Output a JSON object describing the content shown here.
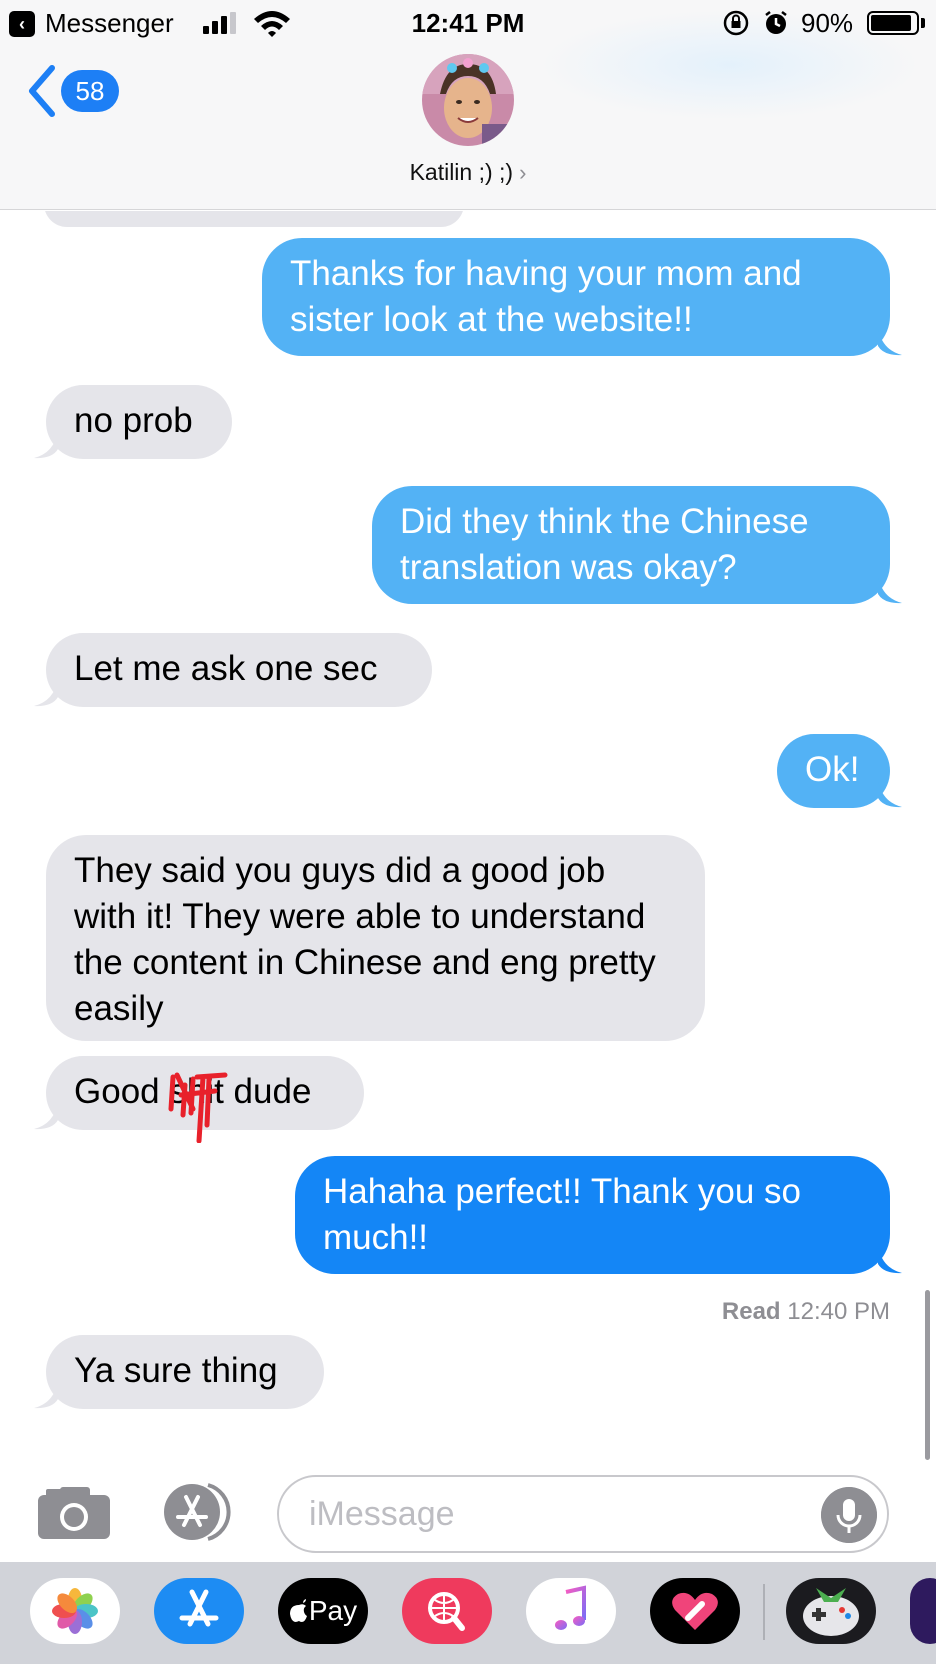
{
  "status_bar": {
    "back_app": "Messenger",
    "time": "12:41 PM",
    "battery": "90%",
    "battery_level": 0.9
  },
  "nav": {
    "unread_count": "58",
    "contact_name": "Katilin ;) ;)",
    "chevron": "›"
  },
  "messages": [
    {
      "from": "me",
      "text": "Thanks for having your mom and sister look at the website!!"
    },
    {
      "from": "them",
      "text": "no prob"
    },
    {
      "from": "me",
      "text": "Did they think the Chinese translation was okay?"
    },
    {
      "from": "them",
      "text": "Let me ask one sec"
    },
    {
      "from": "me",
      "text": "Ok!"
    },
    {
      "from": "them",
      "text": "They said you guys did a good job with it! They were able to understand the content in Chinese and eng pretty easily"
    },
    {
      "from": "them",
      "text_parts": [
        "Good ",
        "shit",
        " dude"
      ],
      "censored_word": "shit"
    },
    {
      "from": "me",
      "text": "Hahaha perfect!! Thank you so much!!"
    },
    {
      "from": "them",
      "text": "Ya sure thing"
    }
  ],
  "read_receipt": {
    "label": "Read",
    "time": "12:40 PM"
  },
  "input": {
    "placeholder": "iMessage"
  },
  "drawer_apps": [
    {
      "name": "Photos",
      "icon": "photos-icon"
    },
    {
      "name": "App Store",
      "icon": "app-store-icon"
    },
    {
      "name": "Pay",
      "label": "Pay",
      "icon": "apple-pay-icon"
    },
    {
      "name": "Web Images",
      "icon": "image-search-icon"
    },
    {
      "name": "Music",
      "icon": "music-icon"
    },
    {
      "name": "Digital Touch",
      "icon": "digital-touch-icon"
    },
    {
      "name": "Game",
      "icon": "game-bird-icon"
    },
    {
      "name": "Partial app",
      "icon": "partial-app-icon"
    }
  ],
  "colors": {
    "incoming_bubble": "#e5e5ea",
    "outgoing_bubble": "#53b2f5",
    "outgoing_bubble_latest": "#1486f6",
    "accent": "#1d7ff5",
    "scribble": "#e8212b"
  }
}
